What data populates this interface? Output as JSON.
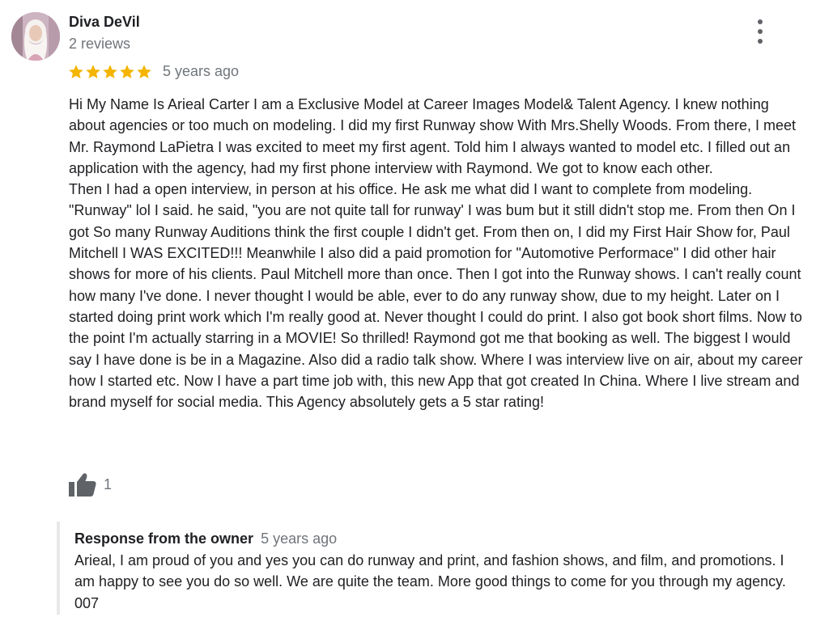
{
  "author": {
    "name": "Diva DeVil",
    "reviews": "2 reviews"
  },
  "rating": {
    "stars": 5,
    "max_stars": 5,
    "date": "5 years ago",
    "star_color": "#f4b400"
  },
  "review": {
    "paragraphs": [
      "Hi My Name Is Arieal Carter I am a Exclusive Model at Career Images Model& Talent Agency. I knew nothing about agencies or too much on modeling. I did my first Runway show With Mrs.Shelly Woods. From there, I meet Mr. Raymond LaPietra I was excited to meet my first agent. Told him I always wanted to model etc. I filled out an application with the agency, had my first phone interview with Raymond. We got to know each other.",
      "Then I had a open interview, in person at his office. He ask me what did I want to complete from modeling. \"Runway\" lol I said. he said, \"you are not quite tall for runway' I was bum but it still didn't stop me. From then On I got So many Runway Auditions think the first couple I didn't get. From then on, I did my First Hair Show for, Paul Mitchell I WAS EXCITED!!! Meanwhile I also did a paid promotion for \"Automotive Performace\" I did other hair shows for more of his clients. Paul Mitchell more than once. Then I got into the Runway shows. I can't really count how many I've done. I never thought I would be able, ever to do any runway show, due to my height. Later on I started doing print work which I'm really good at. Never thought I could do print. I also got book short films. Now to the point I'm actually starring in a MOVIE! So thrilled! Raymond got me that booking as well. The biggest I would say I have done is be in a Magazine. Also did a radio talk show. Where I was interview live on air, about my career how I started etc. Now I have a part time job with, this new App that got created In China. Where I live stream and brand myself for social media. This Agency absolutely gets a 5 star rating!"
    ]
  },
  "likes": {
    "count": "1",
    "icon": "thumbs-up-icon"
  },
  "owner_response": {
    "label": "Response from the owner",
    "date": "5 years ago",
    "text": "Arieal, I am proud of you and yes you can do runway and print, and fashion shows, and film, and promotions. I am happy to see you do so well. We are quite the team. More good things to come for you through my agency. 007"
  },
  "colors": {
    "text": "#202124",
    "secondary": "#70757a",
    "icon": "#5f6368",
    "response_border": "#e8e8e8"
  }
}
